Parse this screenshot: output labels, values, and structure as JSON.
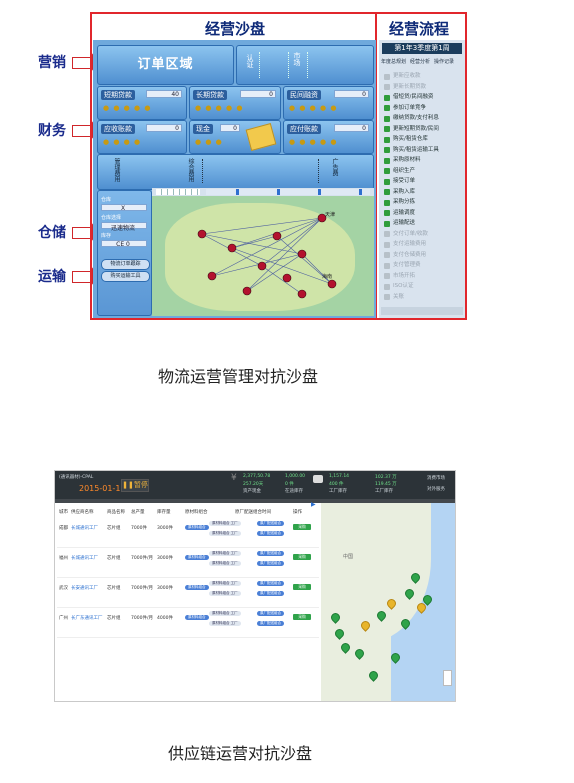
{
  "figure1": {
    "side_labels": [
      "营销",
      "财务",
      "仓储",
      "运输"
    ],
    "sandbox_title": "经营沙盘",
    "flow_title": "经营流程",
    "order_zone": "订单区域",
    "qualification": {
      "label1": "认证",
      "label2": "市场"
    },
    "loan_labels": {
      "short": "短期贷款",
      "long": "长期贷款",
      "other": "民间融资"
    },
    "loan_values": {
      "short": "40",
      "long": "0",
      "other": "0"
    },
    "finance_labels": {
      "receivable": "应收账款",
      "cash": "现金",
      "payable": "应付账款"
    },
    "finance_values": {
      "receivable": "0",
      "cash": "0",
      "payable": "0"
    },
    "cost_labels": [
      "管理费用",
      "综合费用",
      "广告费"
    ],
    "warehouse": {
      "label_a": "仓库",
      "value_a": "X",
      "label_b": "仓库选择",
      "value_b": "迅速物流",
      "label_c": "库存",
      "value_c": "CE 0"
    },
    "transport_buttons": [
      "物流订单跟踪",
      "购买运输工具"
    ],
    "map_city_labels": [
      "天津",
      "海南"
    ],
    "flow": {
      "head": "第1年3季度第1周",
      "tabs": [
        "年度总规划",
        "经营分析",
        "操作记录"
      ],
      "items": [
        {
          "text": "更新应收款",
          "active": false
        },
        {
          "text": "更新长期贷款",
          "active": false
        },
        {
          "text": "借短贷/民间融资",
          "active": true
        },
        {
          "text": "参加订单竞争",
          "active": true
        },
        {
          "text": "缴纳贷款/支付利息",
          "active": true
        },
        {
          "text": "更新短期贷款/民间",
          "active": true
        },
        {
          "text": "购买/租赁仓库",
          "active": true
        },
        {
          "text": "购买/租赁运输工具",
          "active": true
        },
        {
          "text": "采购原材料",
          "active": true
        },
        {
          "text": "组织生产",
          "active": true
        },
        {
          "text": "接受订单",
          "active": true
        },
        {
          "text": "采购入库",
          "active": true
        },
        {
          "text": "采购分拣",
          "active": true
        },
        {
          "text": "运输调度",
          "active": true
        },
        {
          "text": "运输配送",
          "active": true
        },
        {
          "text": "交付订单/收款",
          "active": false
        },
        {
          "text": "支付运输费用",
          "active": false
        },
        {
          "text": "支付仓储费用",
          "active": false
        },
        {
          "text": "支付管理费",
          "active": false
        },
        {
          "text": "市场开拓",
          "active": false
        },
        {
          "text": "ISO认证",
          "active": false
        },
        {
          "text": "关账",
          "active": false
        }
      ]
    },
    "caption": "物流运营管理对抗沙盘"
  },
  "figure2": {
    "company": "(通讯器材)-CPAL",
    "date": "2015-01-17",
    "pause": "暂停",
    "stats": [
      {
        "top": "2,377,50.78",
        "mid": "257.20天",
        "bot": "资产现金"
      },
      {
        "top": "1,000.00",
        "mid": "0 件",
        "bot": "在途库存"
      },
      {
        "top": "1,157.14",
        "mid": "400 件",
        "bot": "工厂库存"
      },
      {
        "top": "102.37 万",
        "mid": "119.45 万",
        "bot": "工厂库存"
      }
    ],
    "top_right": [
      "消费市场",
      "对外服务"
    ],
    "headers": [
      "城市",
      "供应商名称",
      "商品名称",
      "总产量",
      "库存量",
      "原材料组合",
      "原厂配送组合时间",
      "操作"
    ],
    "rows": [
      {
        "city": "成都",
        "supplier": "长城通讯工厂",
        "product": "芯片组",
        "total": "7000件",
        "stock": "3000件"
      },
      {
        "city": "福州",
        "supplier": "长城通讯工厂",
        "product": "芯片组",
        "total": "7000件/月",
        "stock": "3000件"
      },
      {
        "city": "武汉",
        "supplier": "长安通讯工厂",
        "product": "芯片组",
        "total": "7000件/月",
        "stock": "3000件"
      },
      {
        "city": "广州",
        "supplier": "长广东通讯工厂",
        "product": "芯片组",
        "total": "7000件/月",
        "stock": "4000件"
      }
    ],
    "pill_text": "原材料组合",
    "pill_sub": "原材料组合 工厂",
    "pill_right": "原厂配送组合",
    "button": "采购",
    "map_label": "中国",
    "caption": "供应链运营对抗沙盘"
  }
}
